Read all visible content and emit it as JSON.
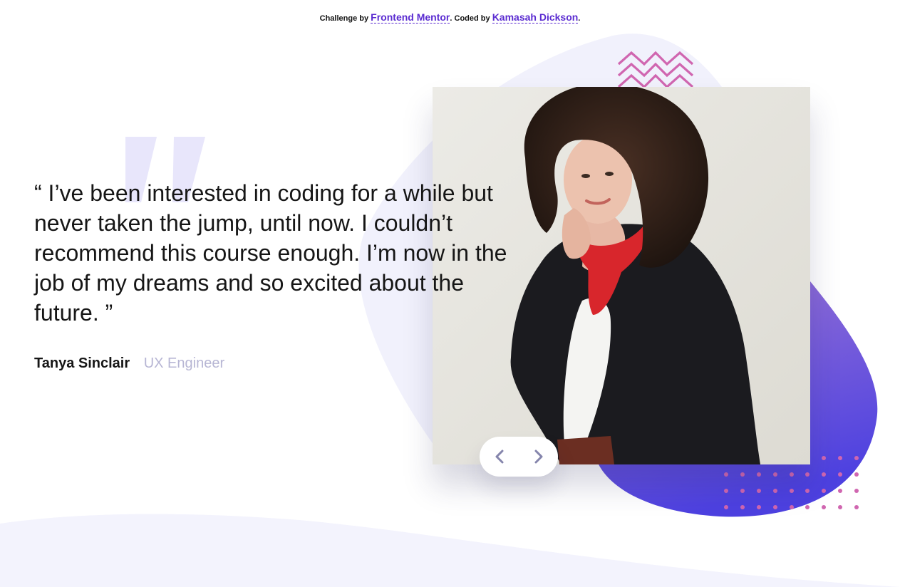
{
  "attribution": {
    "prefix": "Challenge by",
    "challenge_link": "Frontend Mentor",
    "middle": ". Coded by",
    "author_link": "Kamasah Dickson",
    "suffix": "."
  },
  "testimonial": {
    "quote": "“ I’ve been interested in coding for a while but never taken the jump, until now. I couldn’t recommend this course enough. I’m now in the job of my dreams and so excited about the future. ”",
    "name": "Tanya Sinclair",
    "role": "UX Engineer"
  },
  "icons": {
    "quote": "quote-icon",
    "prev": "chevron-left-icon",
    "next": "chevron-right-icon",
    "pattern_zigzag": "zigzag-pattern-icon",
    "pattern_dots": "dots-pattern-icon"
  },
  "colors": {
    "link": "#5a2bd1",
    "text": "#161616",
    "role": "#b7b6d4",
    "blob_light": "#f1f1fc",
    "blob_gradient_start": "#8d6ad8",
    "blob_gradient_end": "#4b3fe0",
    "pattern_accent": "#d066b0",
    "nav_icon": "#8585ac"
  }
}
